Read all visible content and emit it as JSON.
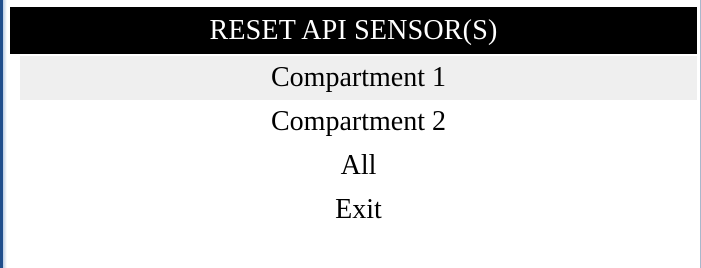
{
  "header": {
    "title": "RESET API SENSOR(S)"
  },
  "menu": {
    "items": [
      {
        "label": "Compartment 1",
        "selected": true
      },
      {
        "label": "Compartment 2",
        "selected": false
      },
      {
        "label": "All",
        "selected": false
      },
      {
        "label": "Exit",
        "selected": false
      }
    ]
  }
}
